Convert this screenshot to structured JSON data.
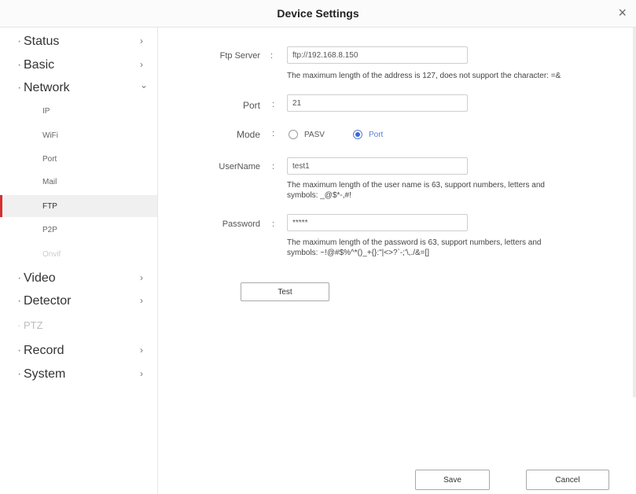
{
  "window": {
    "title": "Device Settings",
    "close_glyph": "×"
  },
  "sidebar": {
    "items": [
      {
        "label": "Status",
        "bullet": "·",
        "chevron": "›"
      },
      {
        "label": "Basic",
        "bullet": "·",
        "chevron": "›"
      },
      {
        "label": "Network",
        "bullet": "·",
        "chevron": "⌄"
      },
      {
        "label": "IP"
      },
      {
        "label": "WiFi"
      },
      {
        "label": "Port"
      },
      {
        "label": "Mail"
      },
      {
        "label": "FTP",
        "active": true
      },
      {
        "label": "P2P"
      },
      {
        "label": "Onvif",
        "disabled": true
      },
      {
        "label": "Video",
        "bullet": "·",
        "chevron": "›"
      },
      {
        "label": "Detector",
        "bullet": "·",
        "chevron": "›"
      },
      {
        "label": "PTZ",
        "bullet": "·",
        "disabled": true
      },
      {
        "label": "Record",
        "bullet": "·",
        "chevron": "›"
      },
      {
        "label": "System",
        "bullet": "·",
        "chevron": "›"
      }
    ]
  },
  "form": {
    "colon": ":",
    "ftp_server": {
      "label": "Ftp Server",
      "value": "ftp://192.168.8.150",
      "hint": "The maximum length of the address is 127, does not support the character: =&"
    },
    "port": {
      "label": "Port",
      "value": "21"
    },
    "mode": {
      "label": "Mode",
      "options": [
        {
          "label": "PASV",
          "checked": false
        },
        {
          "label": "Port",
          "checked": true
        }
      ]
    },
    "username": {
      "label": "UserName",
      "value": "test1",
      "hint_line1": "The maximum length of the user name is 63, support numbers, letters and",
      "hint_line2": "symbols: _@$*-,#!"
    },
    "password": {
      "label": "Password",
      "value": "*****",
      "hint_line1": "The maximum length of the password is 63, support numbers, letters and",
      "hint_line2": "symbols: ~!@#$%^*()_+{}:\"|<>?`-;'\\,./&=[]"
    },
    "test_label": "Test"
  },
  "footer": {
    "save_label": "Save",
    "cancel_label": "Cancel"
  },
  "colors": {
    "accent_red": "#d62f2f",
    "radio_blue": "#3d66d6"
  }
}
